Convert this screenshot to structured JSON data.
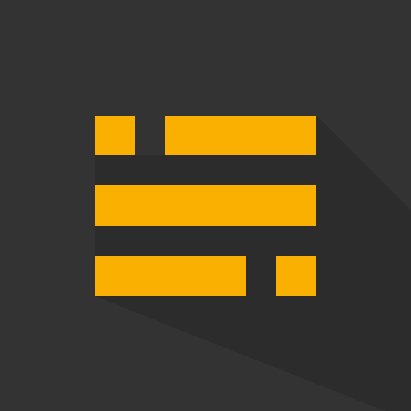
{
  "icon": {
    "semantic": "text-lines-logo-icon",
    "colors": {
      "background": "#333333",
      "shadow": "#2c2c2c",
      "accent": "#f9b000"
    }
  }
}
